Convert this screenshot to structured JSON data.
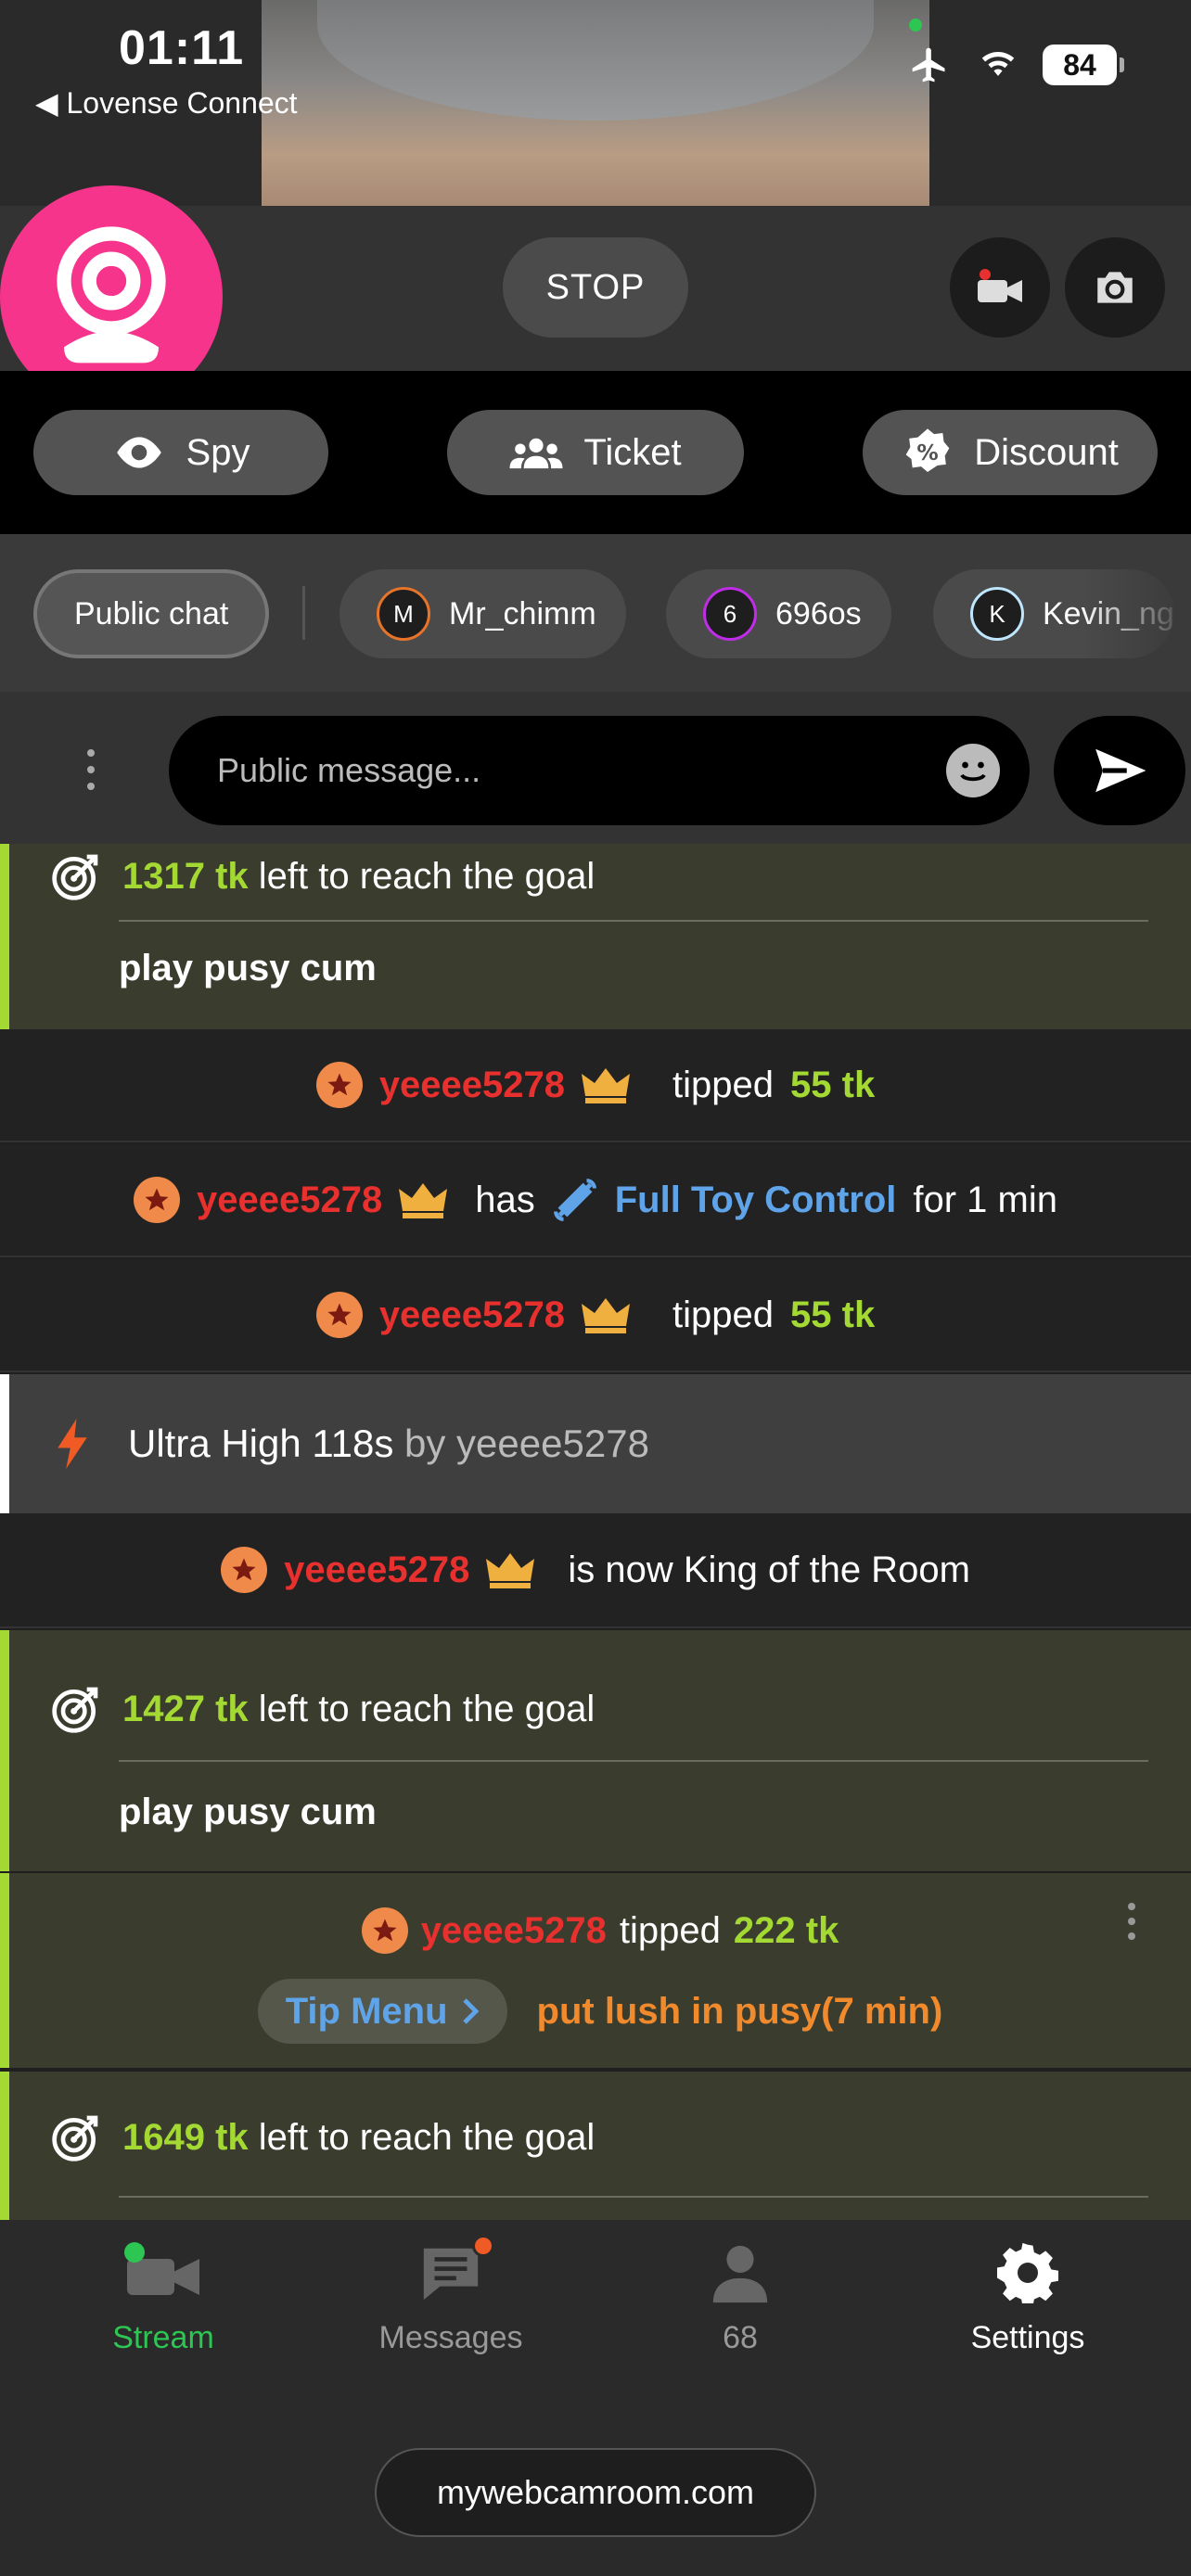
{
  "status_bar": {
    "time": "01:11",
    "back_app": "◀ Lovense Connect",
    "battery": "84"
  },
  "cam_controls": {
    "stop_label": "STOP"
  },
  "actions": {
    "spy": "Spy",
    "ticket": "Ticket",
    "discount": "Discount"
  },
  "chat_tabs": [
    {
      "label": "Public chat",
      "avatar": ""
    },
    {
      "label": "Mr_chimm",
      "avatar": "M",
      "color": "#e8742a"
    },
    {
      "label": "696os",
      "avatar": "6",
      "color": "#c02ce8"
    },
    {
      "label": "Kevin_ng",
      "avatar": "K",
      "color": "#bfe6ff"
    }
  ],
  "message_input": {
    "placeholder": "Public message..."
  },
  "feed": {
    "goal1": {
      "amount": "1317 tk",
      "text": "left to reach the goal",
      "title": "play pusy cum"
    },
    "tip1": {
      "user": "yeeee5278",
      "action": "tipped",
      "amount": "55 tk"
    },
    "control": {
      "user": "yeeee5278",
      "has": "has",
      "link": "Full Toy Control",
      "suffix": "for 1 min"
    },
    "tip2": {
      "user": "yeeee5278",
      "action": "tipped",
      "amount": "55 tk"
    },
    "ultra": {
      "label": "Ultra High 118s",
      "by": "by yeeee5278"
    },
    "king": {
      "user": "yeeee5278",
      "text": "is now King of the Room"
    },
    "goal2": {
      "amount": "1427 tk",
      "text": "left to reach the goal",
      "title": "play pusy cum"
    },
    "tip3": {
      "user": "yeeee5278",
      "action": "tipped",
      "amount": "222 tk",
      "menu": "Tip Menu",
      "item": "put lush in pusy(7 min)"
    },
    "goal3": {
      "amount": "1649 tk",
      "text": "left to reach the goal"
    }
  },
  "nav": {
    "stream": "Stream",
    "messages": "Messages",
    "viewers": "68",
    "settings": "Settings"
  },
  "footer": {
    "domain": "mywebcamroom.com"
  },
  "colors": {
    "accent_green": "#a4d832",
    "brand_pink": "#f7348c",
    "user_red": "#e8302e",
    "stream_green": "#2dc653"
  }
}
